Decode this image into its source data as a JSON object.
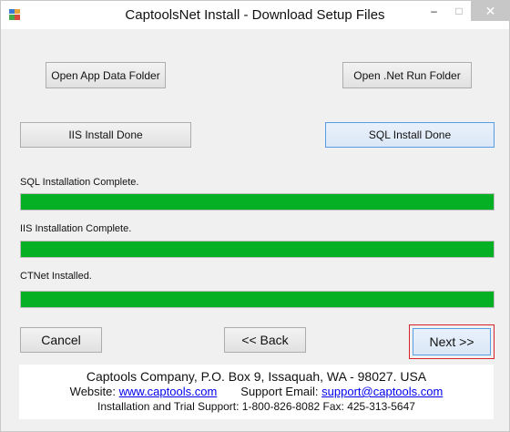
{
  "window": {
    "title": "CaptoolsNet Install - Download Setup Files",
    "minimize_glyph": "–",
    "maximize_glyph": "□",
    "close_glyph": "✕",
    "app_icon": "installer-app-icon"
  },
  "buttons": {
    "open_app_data": "Open App Data Folder",
    "open_net_run": "Open .Net Run Folder",
    "iis_install_done": "IIS Install Done",
    "sql_install_done": "SQL Install Done",
    "cancel": "Cancel",
    "back": "<< Back",
    "next": "Next >>"
  },
  "status": [
    {
      "label": "SQL Installation Complete.",
      "progress": 1.0
    },
    {
      "label": "IIS Installation Complete.",
      "progress": 1.0
    },
    {
      "label": "CTNet Installed.",
      "progress": 1.0
    }
  ],
  "footer": {
    "company": "Captools Company, P.O. Box 9, Issaquah, WA - 98027.  USA",
    "website_label": "Website:",
    "website_link": "www.captools.com",
    "support_label": "Support Email:",
    "support_link": "support@captools.com",
    "phone_line": "Installation and Trial Support:  1-800-826-8082 Fax: 425-313-5647"
  },
  "colors": {
    "progress_fill": "#06b025",
    "focus_border": "#569de5",
    "next_highlight": "#d9232c",
    "link": "#0000ee"
  }
}
